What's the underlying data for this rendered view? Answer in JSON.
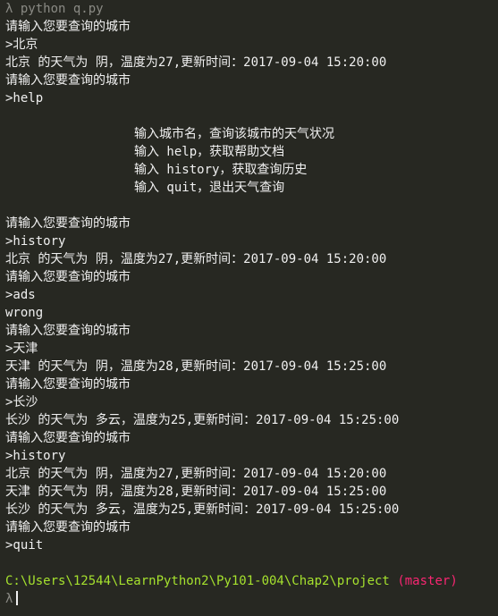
{
  "terminal": {
    "command_prompt": "λ python q.py",
    "lines": [
      {
        "type": "out",
        "text": "请输入您要查询的城市"
      },
      {
        "type": "in",
        "text": ">北京"
      },
      {
        "type": "out",
        "text": "北京 的天气为 阴，温度为27,更新时间：2017-09-04 15:20:00"
      },
      {
        "type": "out",
        "text": "请输入您要查询的城市"
      },
      {
        "type": "in",
        "text": ">help"
      },
      {
        "type": "blank",
        "text": ""
      },
      {
        "type": "help",
        "text": "输入城市名，查询该城市的天气状况"
      },
      {
        "type": "help",
        "text": "输入 help，获取帮助文档"
      },
      {
        "type": "help",
        "text": "输入 history，获取查询历史"
      },
      {
        "type": "help",
        "text": "输入 quit，退出天气查询"
      },
      {
        "type": "blank",
        "text": ""
      },
      {
        "type": "out",
        "text": "请输入您要查询的城市"
      },
      {
        "type": "in",
        "text": ">history"
      },
      {
        "type": "out",
        "text": "北京 的天气为 阴，温度为27,更新时间：2017-09-04 15:20:00"
      },
      {
        "type": "out",
        "text": "请输入您要查询的城市"
      },
      {
        "type": "in",
        "text": ">ads"
      },
      {
        "type": "out",
        "text": "wrong"
      },
      {
        "type": "out",
        "text": "请输入您要查询的城市"
      },
      {
        "type": "in",
        "text": ">天津"
      },
      {
        "type": "out",
        "text": "天津 的天气为 阴，温度为28,更新时间：2017-09-04 15:25:00"
      },
      {
        "type": "out",
        "text": "请输入您要查询的城市"
      },
      {
        "type": "in",
        "text": ">长沙"
      },
      {
        "type": "out",
        "text": "长沙 的天气为 多云，温度为25,更新时间：2017-09-04 15:25:00"
      },
      {
        "type": "out",
        "text": "请输入您要查询的城市"
      },
      {
        "type": "in",
        "text": ">history"
      },
      {
        "type": "out",
        "text": "北京 的天气为 阴，温度为27,更新时间：2017-09-04 15:20:00"
      },
      {
        "type": "out",
        "text": "天津 的天气为 阴，温度为28,更新时间：2017-09-04 15:25:00"
      },
      {
        "type": "out",
        "text": "长沙 的天气为 多云，温度为25,更新时间：2017-09-04 15:25:00"
      },
      {
        "type": "out",
        "text": "请输入您要查询的城市"
      },
      {
        "type": "in",
        "text": ">quit"
      },
      {
        "type": "blank",
        "text": ""
      }
    ],
    "cwd": "C:\\Users\\12544\\LearnPython2\\Py101-004\\Chap2\\project",
    "branch": "(master)",
    "final_prompt": "λ"
  },
  "colors": {
    "background": "#272822",
    "text": "#f0f0f0",
    "path": "#a6e22e",
    "branch": "#f92672"
  }
}
